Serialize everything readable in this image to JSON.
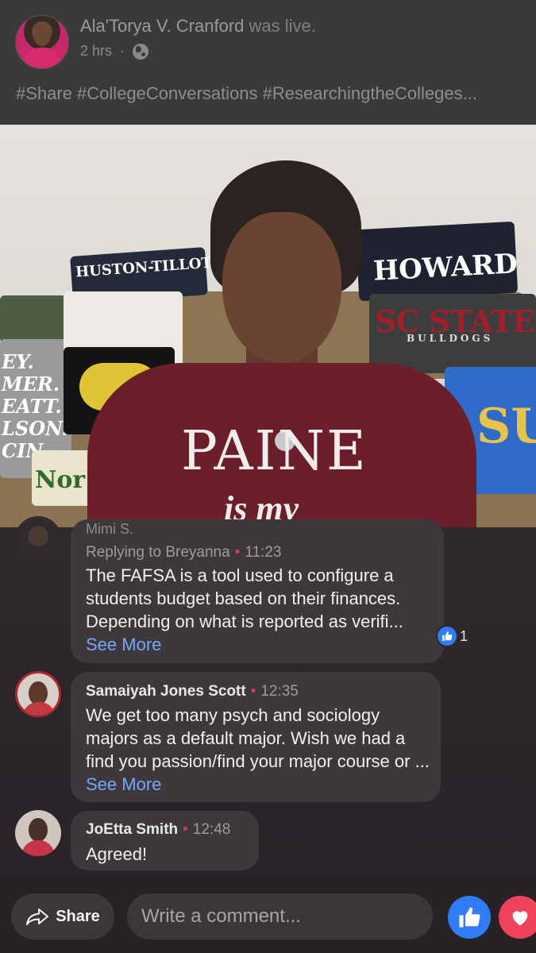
{
  "post": {
    "author": "Ala'Torya V. Cranford",
    "action": "was live.",
    "time": "2 hrs",
    "privacy_icon": "globe-icon",
    "hashtags": "#Share #CollegeConversations #ResearchingtheColleges..."
  },
  "video": {
    "shirt_main": "PAINE",
    "shirt_main_sub": "is my",
    "shirts": {
      "howard": "HOWARD",
      "scstate": "SC STATE",
      "scstate_sub": "BULLDOGS",
      "huston": "HUSTON-TILLOTSON",
      "blue": "SU",
      "gray": "EY.\nMER.\nEATT.\nLSON.\nCIN.",
      "nor": "Nor"
    }
  },
  "comments": [
    {
      "name_partial": "Mimi S.",
      "reply_to": "Replying to Breyanna",
      "time": "11:23",
      "text": "The FAFSA is a tool used to configure a students budget based on their finances. Depending on what is reported as verifi...",
      "see_more": "See More",
      "reaction_count": "1"
    },
    {
      "name": "Samaiyah Jones Scott",
      "time": "12:35",
      "text": "We get too many psych and sociology majors as a default major. Wish we had a find you passion/find your major course or ...",
      "see_more": "See More"
    },
    {
      "name": "JoEtta Smith",
      "time": "12:48",
      "text": "Agreed!"
    }
  ],
  "actions": {
    "share_label": "Share",
    "comment_placeholder": "Write a comment...",
    "like_icon": "thumbs-up-icon",
    "love_icon": "heart-icon"
  },
  "colors": {
    "like_blue": "#2f7cf6",
    "love_red": "#f0425a",
    "link_blue": "#7aa6f7",
    "dot_red": "#d0404a"
  }
}
